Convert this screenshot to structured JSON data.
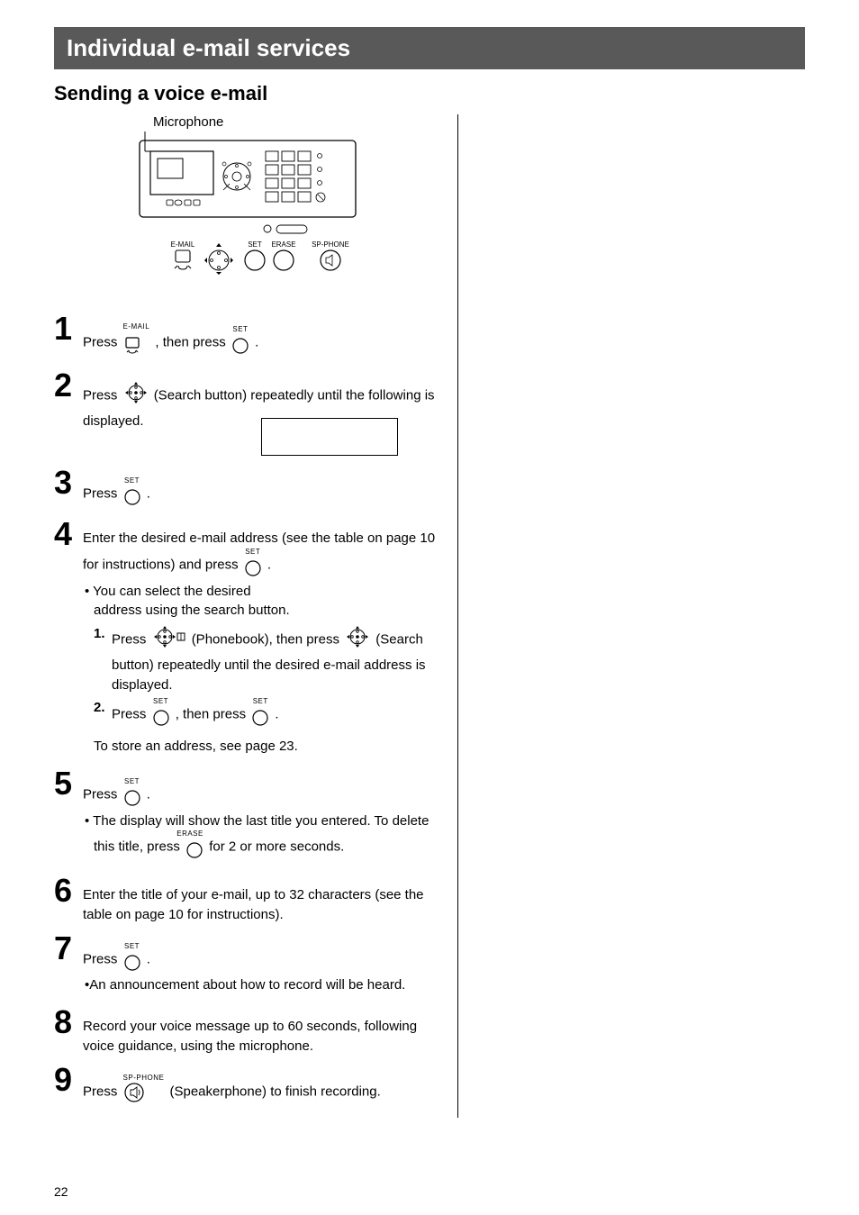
{
  "title": "Individual e-mail services",
  "subtitle": "Sending a voice e-mail",
  "micLabel": "Microphone",
  "deviceLabels": {
    "email": "E-MAIL",
    "set": "SET",
    "erase": "ERASE",
    "spphone": "SP-PHONE"
  },
  "iconLabels": {
    "email": "E-MAIL",
    "set": "SET",
    "erase": "ERASE",
    "spphone": "SP-PHONE"
  },
  "steps": {
    "s1a": "Press ",
    "s1b": " , then press ",
    "s1c": " .",
    "s2a": "Press ",
    "s2b": " (Search button) repeatedly until the following is displayed.",
    "s3a": "Press ",
    "s3b": " .",
    "s4a": "Enter the desired e-mail address (see the table on page 10 for instructions) and press ",
    "s4b": " .",
    "s4bullet1a": "You can select the desired",
    "s4bullet1b": "address using the search button.",
    "s4sub1a": "Press ",
    "s4sub1b": " (Phonebook), then press ",
    "s4sub1c": " (Search button) repeatedly until the desired e-mail address is displayed.",
    "s4sub2a": "Press ",
    "s4sub2b": " , then press ",
    "s4sub2c": " .",
    "s4after": "To store an address, see page 23.",
    "s5a": "Press ",
    "s5b": " .",
    "s5bullet_a": "The display will show the last title you entered. To delete this title, press ",
    "s5bullet_b": " for 2 or more seconds.",
    "s6": "Enter the title of your e-mail, up to 32 characters (see the table on page 10 for instructions).",
    "s7a": "Press ",
    "s7b": " .",
    "s7bullet": "An announcement about how to record will be heard.",
    "s8": "Record your voice message up to 60 seconds, following voice guidance, using the microphone.",
    "s9a": "Press ",
    "s9b": " (Speakerphone) to finish recording."
  },
  "pageNum": "22"
}
